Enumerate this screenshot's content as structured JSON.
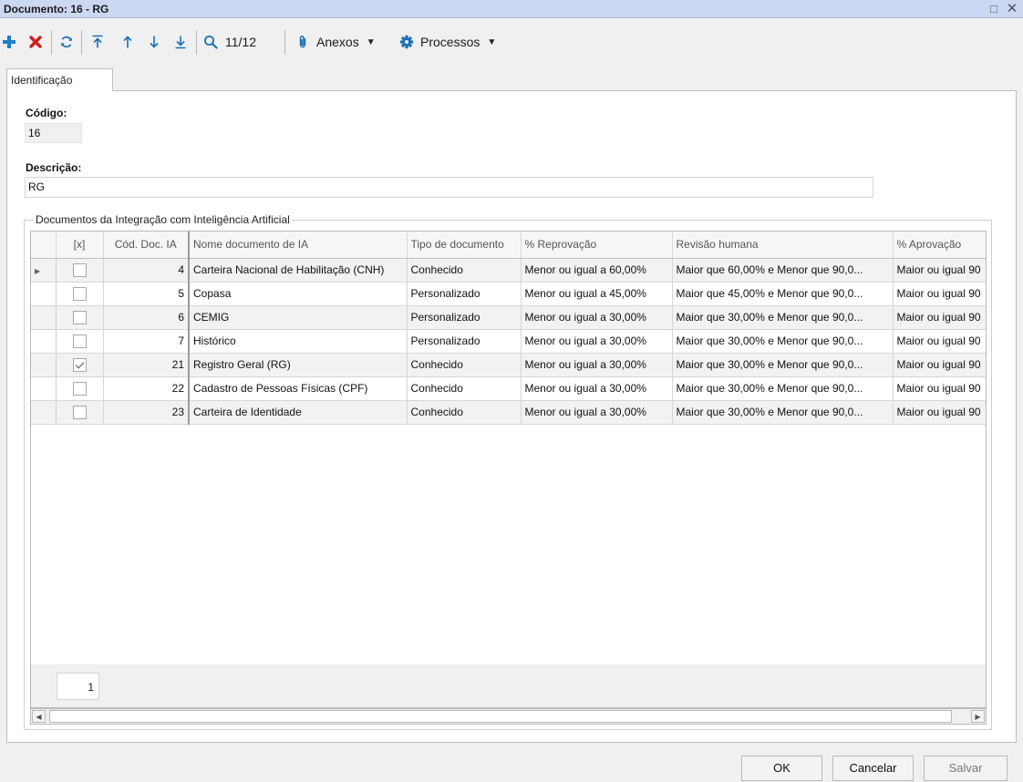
{
  "window": {
    "title": "Documento: 16 - RG"
  },
  "toolbar": {
    "record_position": "11/12",
    "attachments_label": "Anexos",
    "processes_label": "Processos",
    "colors": {
      "add": "#1e80c8",
      "delete": "#cc1f1f",
      "icon": "#1a6fb5"
    }
  },
  "tabs": [
    {
      "label": "Identificação"
    }
  ],
  "form": {
    "code_label": "Código:",
    "code_value": "16",
    "description_label": "Descrição:",
    "description_value": "RG"
  },
  "grid": {
    "group_title": "Documentos da Integração com Inteligência Artificial",
    "columns": [
      "[x]",
      "Cód. Doc. IA",
      "Nome documento de IA",
      "Tipo de documento",
      "% Reprovação",
      "Revisão humana",
      "% Aprovação"
    ],
    "rows": [
      {
        "checked": false,
        "code": "4",
        "name": "Carteira Nacional de Habilitação (CNH)",
        "type": "Conhecido",
        "reprovacao": "Menor ou igual a 60,00%",
        "revisao": "Maior que 60,00% e Menor que 90,0...",
        "aprovacao": "Maior ou igual 90"
      },
      {
        "checked": false,
        "code": "5",
        "name": "Copasa",
        "type": "Personalizado",
        "reprovacao": "Menor ou igual a 45,00%",
        "revisao": "Maior que 45,00% e Menor que 90,0...",
        "aprovacao": "Maior ou igual 90"
      },
      {
        "checked": false,
        "code": "6",
        "name": "CEMIG",
        "type": "Personalizado",
        "reprovacao": "Menor ou igual a 30,00%",
        "revisao": "Maior que 30,00% e Menor que 90,0...",
        "aprovacao": "Maior ou igual 90"
      },
      {
        "checked": false,
        "code": "7",
        "name": "Histórico",
        "type": "Personalizado",
        "reprovacao": "Menor ou igual a 30,00%",
        "revisao": "Maior que 30,00% e Menor que 90,0...",
        "aprovacao": "Maior ou igual 90"
      },
      {
        "checked": true,
        "code": "21",
        "name": "Registro Geral (RG)",
        "type": "Conhecido",
        "reprovacao": "Menor ou igual a 30,00%",
        "revisao": "Maior que 30,00% e Menor que 90,0...",
        "aprovacao": "Maior ou igual 90"
      },
      {
        "checked": false,
        "code": "22",
        "name": "Cadastro de Pessoas Físicas (CPF)",
        "type": "Conhecido",
        "reprovacao": "Menor ou igual a 30,00%",
        "revisao": "Maior que 30,00% e Menor que 90,0...",
        "aprovacao": "Maior ou igual 90"
      },
      {
        "checked": false,
        "code": "23",
        "name": "Carteira de Identidade",
        "type": "Conhecido",
        "reprovacao": "Menor ou igual a 30,00%",
        "revisao": "Maior que 30,00% e Menor que 90,0...",
        "aprovacao": "Maior ou igual 90"
      }
    ],
    "page_number": "1"
  },
  "footer": {
    "ok_label": "OK",
    "cancel_label": "Cancelar",
    "save_label": "Salvar"
  }
}
